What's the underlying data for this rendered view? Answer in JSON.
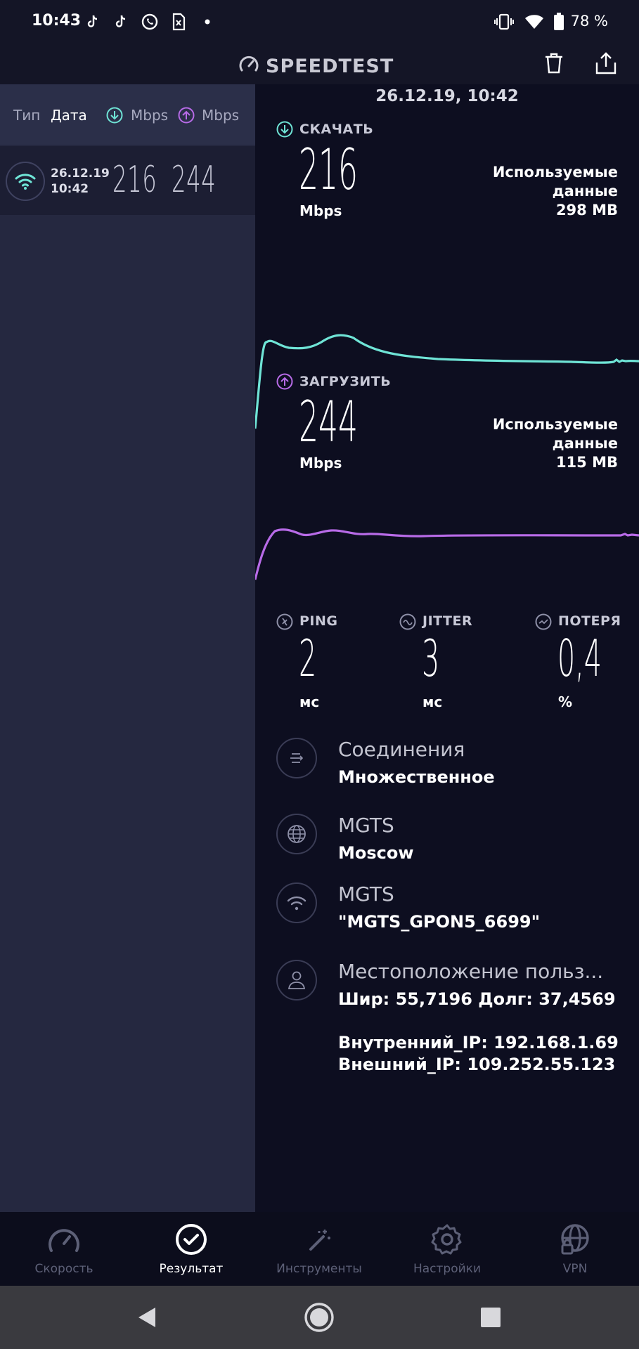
{
  "status_bar": {
    "time": "10:43",
    "battery": "78 %",
    "notification_icons": [
      "tiktok-icon",
      "tiktok-icon",
      "whatsapp-icon",
      "sim-error-icon",
      "dot-icon"
    ],
    "system_icons": [
      "vibrate-icon",
      "wifi-icon",
      "battery-icon"
    ]
  },
  "header": {
    "brand": "SPEEDTEST",
    "actions": [
      "trash-icon",
      "share-icon"
    ]
  },
  "history": {
    "columns": {
      "type": "Тип",
      "date": "Дата",
      "download": "Mbps",
      "upload": "Mbps"
    },
    "rows": [
      {
        "date": "26.12.19",
        "time": "10:42",
        "download": "216",
        "upload": "244"
      }
    ]
  },
  "result": {
    "datetime": "26.12.19, 10:42",
    "download": {
      "label": "СКАЧАТЬ",
      "value": "216",
      "unit": "Mbps",
      "used_label_1": "Используемые",
      "used_label_2": "данные",
      "used_value": "298 MB",
      "color": "#6fe4d6"
    },
    "upload": {
      "label": "ЗАГРУЗИТЬ",
      "value": "244",
      "unit": "Mbps",
      "used_label_1": "Используемые",
      "used_label_2": "данные",
      "used_value": "115 MB",
      "color": "#b86be8"
    },
    "ping": {
      "label": "PING",
      "value": "2",
      "unit": "мс"
    },
    "jitter": {
      "label": "JITTER",
      "value": "3",
      "unit": "мс"
    },
    "loss": {
      "label": "ПОТЕРЯ",
      "value": "0,4",
      "unit": "%"
    },
    "connections": {
      "title": "Соединения",
      "value": "Множественное"
    },
    "provider": {
      "title": "MGTS",
      "value": "Moscow"
    },
    "network": {
      "title": "MGTS",
      "value": "\"MGTS_GPON5_6699\""
    },
    "location": {
      "title": "Местоположение польз...",
      "coords": "Шир: 55,7196 Долг: 37,4569",
      "internal_ip": "Внутренний_IP: 192.168.1.69",
      "external_ip": "Внешний_IP: 109.252.55.123"
    }
  },
  "bottom_nav": {
    "items": [
      {
        "label": "Скорость",
        "icon": "speedometer-icon"
      },
      {
        "label": "Результат",
        "icon": "check-circle-icon"
      },
      {
        "label": "Инструменты",
        "icon": "magic-wand-icon"
      },
      {
        "label": "Настройки",
        "icon": "gear-icon"
      },
      {
        "label": "VPN",
        "icon": "globe-lock-icon"
      }
    ],
    "active": "Результат"
  },
  "system_nav": [
    "back-icon",
    "home-icon",
    "recents-icon"
  ]
}
